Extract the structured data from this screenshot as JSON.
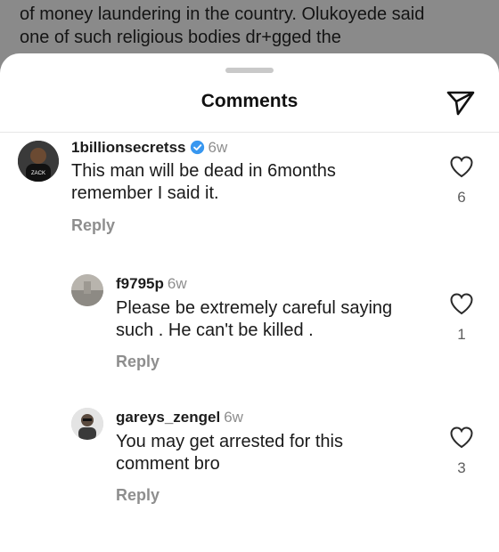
{
  "article": {
    "line1": "of money laundering in the country. Olukoyede said",
    "line2": "one of such religious bodies dr+gged the"
  },
  "sheet": {
    "title": "Comments"
  },
  "comments": [
    {
      "username": "1billionsecretss",
      "verified": true,
      "time": "6w",
      "line1": "This man will be dead in 6months",
      "line2": "remember I said it.",
      "likes": "6",
      "reply_label": "Reply",
      "avatar_text": "ZACK"
    },
    {
      "username": "f9795p",
      "verified": false,
      "time": "6w",
      "line1": "Please be extremely careful saying",
      "line2": "such .  He can't be killed .",
      "likes": "1",
      "reply_label": "Reply"
    },
    {
      "username": "gareys_zengel",
      "verified": false,
      "time": "6w",
      "line1": "You may get arrested for this",
      "line2": "comment bro",
      "likes": "3",
      "reply_label": "Reply"
    }
  ],
  "colors": {
    "verified_badge": "#3897f0",
    "secondary_text": "#8e8e8e",
    "overlay": "#8a8a8a"
  },
  "icons": [
    "send-icon",
    "heart-icon",
    "verified-badge-icon"
  ]
}
